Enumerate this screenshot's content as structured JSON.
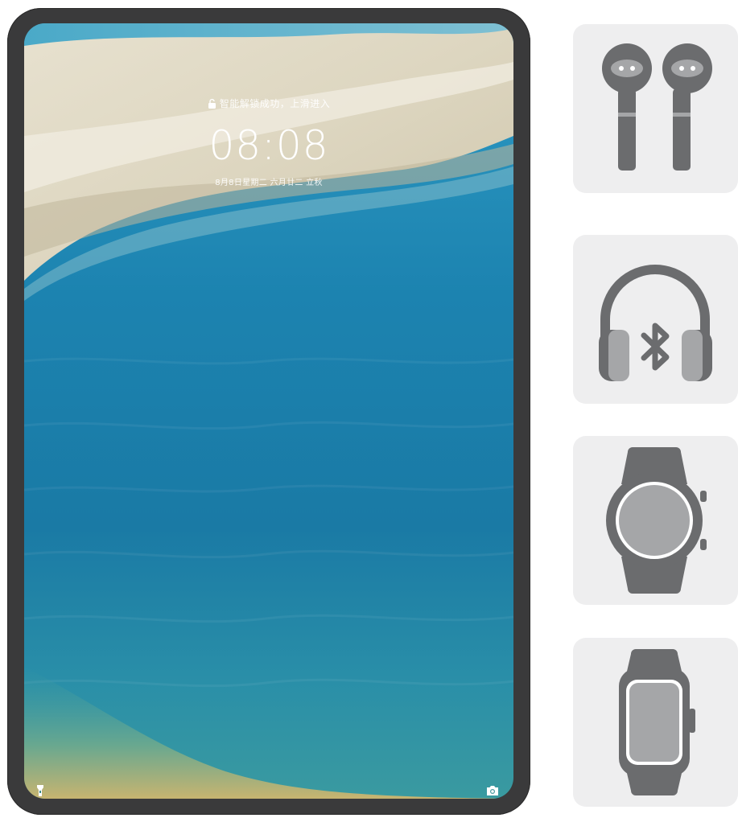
{
  "lockscreen": {
    "unlock_hint": "智能解锁成功，上滑进入",
    "time": "08:08",
    "date": "8月8日星期二  六月廿二  立秋"
  },
  "icons": {
    "lock": "unlock-icon",
    "flashlight": "flashlight-icon",
    "camera": "camera-icon"
  },
  "devices": [
    {
      "name": "earbuds-icon"
    },
    {
      "name": "bluetooth-headphones-icon"
    },
    {
      "name": "round-smartwatch-icon"
    },
    {
      "name": "square-smartwatch-icon"
    }
  ],
  "colors": {
    "bezel": "#3a3a3b",
    "tile_bg": "#eeeeef",
    "icon_dark": "#6b6c6e",
    "icon_light": "#a5a6a8"
  }
}
